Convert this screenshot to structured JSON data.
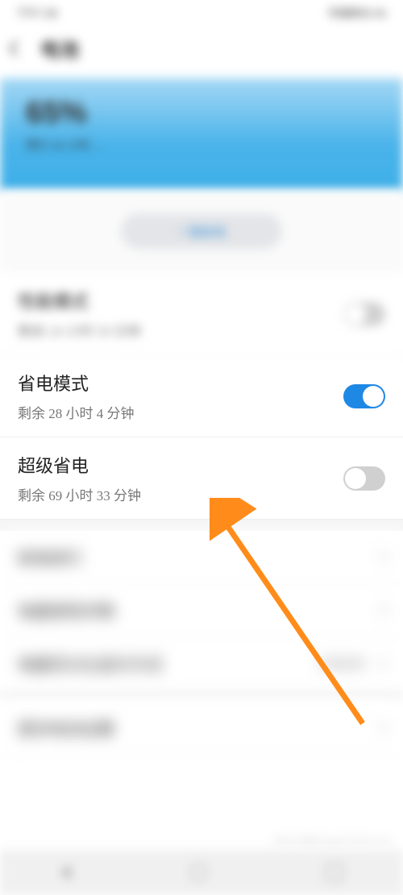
{
  "status_bar": {
    "left_text": "下午7:38",
    "right_text": "中国移动 4G"
  },
  "header": {
    "title": "电池"
  },
  "battery": {
    "percent": "65%",
    "sub": "预计 24 小时 …"
  },
  "pill_label": "一键省电",
  "modes": [
    {
      "title": "性能模式",
      "sub": "剩余 24 小时 59 分钟",
      "toggle": "off",
      "blurred": true
    },
    {
      "title": "省电模式",
      "sub": "剩余 28 小时 4 分钟",
      "toggle": "on",
      "blurred": false
    },
    {
      "title": "超级省电",
      "sub": "剩余 69 小时 33 分钟",
      "toggle": "off",
      "blurred": false
    }
  ],
  "other_rows": [
    {
      "title": "耗电排行",
      "right": ""
    },
    {
      "title": "电量使用详情",
      "right": ""
    },
    {
      "title": "电量百分比显示方式",
      "right": "在电池外"
    }
  ],
  "more_row": {
    "title": "更多电池设置"
  },
  "watermark": "Baidu 经验 jingyan.baidu.com"
}
